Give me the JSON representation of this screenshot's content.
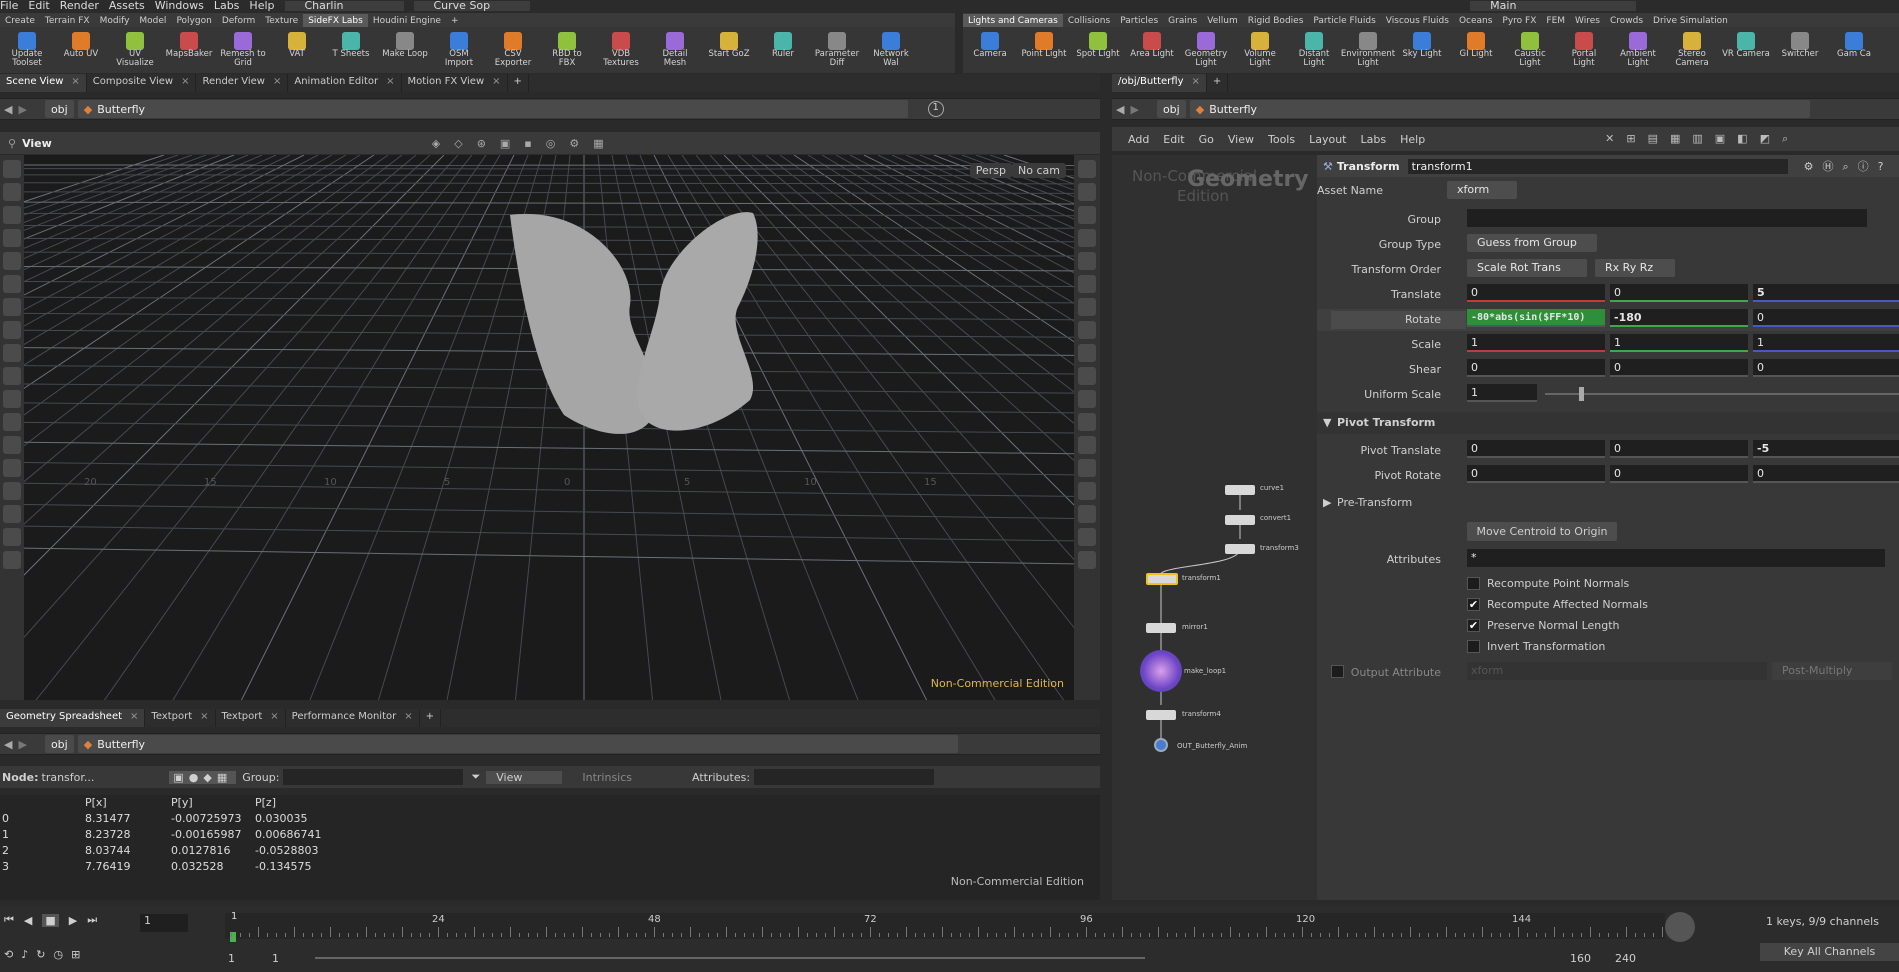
{
  "menubar": {
    "items": [
      "File",
      "Edit",
      "Render",
      "Assets",
      "Windows",
      "Labs",
      "Help"
    ],
    "desktop": "Charlin",
    "context": "Curve Sop",
    "main": "Main"
  },
  "shelf_left": {
    "tabs": [
      "Create",
      "Terrain FX",
      "Modify",
      "Model",
      "Polygon",
      "Deform",
      "Texture",
      "SideFX Labs",
      "Houdini Engine"
    ],
    "active": "SideFX Labs",
    "tools": [
      "Update Toolset",
      "Auto UV",
      "UV Visualize",
      "MapsBaker",
      "Remesh to Grid",
      "VAT",
      "T Sheets",
      "Make Loop",
      "OSM Import",
      "CSV Exporter",
      "RBD to FBX",
      "VDB Textures",
      "Detail Mesh",
      "Start GoZ",
      "Ruler",
      "Parameter Diff",
      "Network Wal"
    ]
  },
  "shelf_right": {
    "tabs": [
      "Lights and Cameras",
      "Collisions",
      "Particles",
      "Grains",
      "Vellum",
      "Rigid Bodies",
      "Particle Fluids",
      "Viscous Fluids",
      "Oceans",
      "Pyro FX",
      "FEM",
      "Wires",
      "Crowds",
      "Drive Simulation"
    ],
    "active": "Lights and Cameras",
    "tools": [
      "Camera",
      "Point Light",
      "Spot Light",
      "Area Light",
      "Geometry Light",
      "Volume Light",
      "Distant Light",
      "Environment Light",
      "Sky Light",
      "GI Light",
      "Caustic Light",
      "Portal Light",
      "Ambient Light",
      "Stereo Camera",
      "VR Camera",
      "Switcher",
      "Gam Ca"
    ]
  },
  "scene_tabs": [
    "Scene View",
    "Composite View",
    "Render View",
    "Animation Editor",
    "Motion FX View"
  ],
  "path": {
    "root": "obj",
    "node": "Butterfly",
    "count": "1"
  },
  "viewport": {
    "title": "View",
    "persp": "Persp",
    "cam": "No cam",
    "watermark": "Non-Commercial Edition",
    "grid_labels": [
      "20",
      "15",
      "10",
      "5",
      "0",
      "5",
      "10",
      "15"
    ]
  },
  "network": {
    "tab": "/obj/Butterfly",
    "root": "obj",
    "node": "Butterfly",
    "menus": [
      "Add",
      "Edit",
      "Go",
      "View",
      "Tools",
      "Layout",
      "Labs",
      "Help"
    ],
    "watermark1": "Non-Commercial",
    "watermark2": "Edition",
    "watermark_big": "Geometry",
    "nodes": [
      "curve1",
      "convert1",
      "transform3",
      "transform1",
      "mirror1",
      "make_loop1",
      "transform4",
      "OUT_Butterfly_Anim"
    ]
  },
  "params": {
    "type": "Transform",
    "name": "transform1",
    "asset_label": "Asset Name",
    "asset": "xform",
    "group_label": "Group",
    "group_type_label": "Group Type",
    "group_type": "Guess from Group",
    "order_label": "Transform Order",
    "order": "Scale Rot Trans",
    "rot_order": "Rx Ry Rz",
    "translate_label": "Translate",
    "translate": [
      "0",
      "0",
      "5"
    ],
    "rotate_label": "Rotate",
    "rotate": [
      "-80*abs(sin($FF*10)",
      "-180",
      "0"
    ],
    "scale_label": "Scale",
    "scale": [
      "1",
      "1",
      "1"
    ],
    "shear_label": "Shear",
    "shear": [
      "0",
      "0",
      "0"
    ],
    "uscale_label": "Uniform Scale",
    "uscale": "1",
    "pivot_section": "Pivot Transform",
    "pivot_t_label": "Pivot Translate",
    "pivot_t": [
      "0",
      "0",
      "-5"
    ],
    "pivot_r_label": "Pivot Rotate",
    "pivot_r": [
      "0",
      "0",
      "0"
    ],
    "pre_section": "Pre-Transform",
    "centroid_btn": "Move Centroid to Origin",
    "attributes_label": "Attributes",
    "attributes": "*",
    "checks": [
      {
        "label": "Recompute Point Normals",
        "on": false
      },
      {
        "label": "Recompute Affected Normals",
        "on": true
      },
      {
        "label": "Preserve Normal Length",
        "on": true
      },
      {
        "label": "Invert Transformation",
        "on": false
      }
    ],
    "output_label": "Output Attribute",
    "output_placeholder": "xform",
    "output_mode": "Post-Multiply"
  },
  "sheet": {
    "tabs": [
      "Geometry Spreadsheet",
      "Textport",
      "Textport",
      "Performance Monitor"
    ],
    "node_label": "Node:",
    "node": "transfor...",
    "group_label": "Group:",
    "view": "View",
    "intrinsics": "Intrinsics",
    "attributes_label": "Attributes:",
    "headers": [
      "P[x]",
      "P[y]",
      "P[z]"
    ],
    "rows": [
      [
        "0",
        "8.31477",
        "-0.00725973",
        "0.030035"
      ],
      [
        "1",
        "8.23728",
        "-0.00165987",
        "0.00686741"
      ],
      [
        "2",
        "8.03744",
        "0.0127816",
        "-0.0528803"
      ],
      [
        "3",
        "7.76419",
        "0.032528",
        "-0.134575"
      ]
    ],
    "watermark": "Non-Commercial Edition"
  },
  "timeline": {
    "frame": "1",
    "marks": [
      "24",
      "48",
      "72",
      "96",
      "120",
      "144"
    ],
    "start": "1",
    "start2": "1",
    "end": "160",
    "end2": "240",
    "keys": "1 keys, 9/9 channels",
    "key_all": "Key All Channels",
    "current_marker": "1"
  }
}
